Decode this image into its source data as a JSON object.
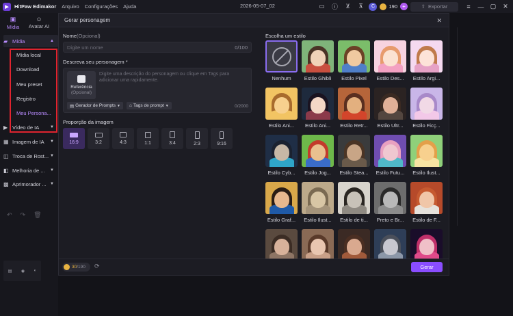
{
  "titlebar": {
    "app_name": "HitPaw Edimakor",
    "menu": [
      "Arquivo",
      "Configurações",
      "Ajuda"
    ],
    "date": "2026-05-07_02",
    "avatar_letter": "C",
    "credits": "190",
    "export_label": "Exportar"
  },
  "left": {
    "tabs": [
      {
        "label": "Mídia"
      },
      {
        "label": "Avatar AI"
      }
    ],
    "media_label": "Mídia",
    "submenu": [
      "Mídia local",
      "Download",
      "Meu preset",
      "Registro",
      "Meu Persona..."
    ],
    "nav": [
      "Vídeo de IA",
      "Imagem de IA",
      "Troca de Rost...",
      "Melhoria de ...",
      "Aprimorador ..."
    ]
  },
  "modal": {
    "title": "Gerar personagem",
    "name_label": "Nome",
    "name_optional": "(Opcional)",
    "name_placeholder": "Digite um nome",
    "name_count": "0/100",
    "desc_label": "Descreva seu personagem *",
    "ref_label": "Referência",
    "ref_optional": "(Opcional)",
    "desc_placeholder": "Digite uma descrição do personagem ou clique em Tags para adicionar uma rapidamente.",
    "prompt_gen": "Gerador de Prompts",
    "prompt_tags": "Tags de prompt",
    "desc_count": "0/2000",
    "ratio_label": "Proporção da imagem",
    "ratios": [
      "16:9",
      "3:2",
      "4:3",
      "1:1",
      "3:4",
      "2:3",
      "9:16"
    ],
    "credits_current": "30",
    "credits_total": "/190",
    "generate_label": "Gerar",
    "styles_title": "Escolha um estilo",
    "styles": [
      "Nenhum",
      "Estilo Ghibli",
      "Estilo Pixel",
      "Estilo Des...",
      "Estilo Argi...",
      "Estilo Ani...",
      "Estilo Ani...",
      "Estilo Retr...",
      "Estilo Ultr...",
      "Estilo Ficç...",
      "Estilo Cyb...",
      "Estilo Jog...",
      "Estilo Stea...",
      "Estilo Futu...",
      "Estilo Ilust...",
      "Estilo Graf...",
      "Estilo Ilust...",
      "Estilo de ti...",
      "Preto e Br...",
      "Estilo de F...",
      "",
      "",
      "",
      "",
      ""
    ]
  },
  "colors": {
    "accent": "#8a4dff",
    "highlight_border": "#e0242f"
  }
}
